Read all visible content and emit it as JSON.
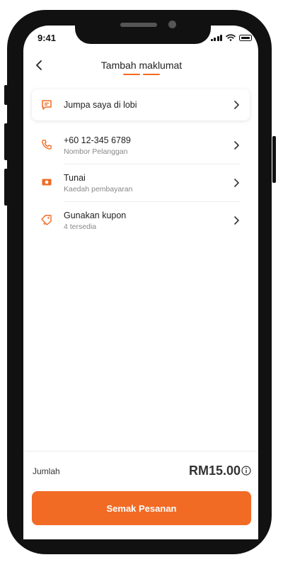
{
  "status_bar": {
    "time": "9:41"
  },
  "header": {
    "title": "Tambah maklumat"
  },
  "list": [
    {
      "main": "Jumpa saya di lobi",
      "sub": "",
      "icon": "chat-note-icon"
    },
    {
      "main": "+60 12-345 6789",
      "sub": "Nombor Pelanggan",
      "icon": "phone-icon"
    },
    {
      "main": "Tunai",
      "sub": "Kaedah pembayaran",
      "icon": "cash-icon"
    },
    {
      "main": "Gunakan kupon",
      "sub": "4 tersedia",
      "icon": "coupon-icon"
    }
  ],
  "footer": {
    "total_label": "Jumlah",
    "total_amount": "RM15.00",
    "cta_label": "Semak Pesanan"
  },
  "colors": {
    "accent": "#f16b25",
    "text": "#222222",
    "muted": "#888888"
  }
}
